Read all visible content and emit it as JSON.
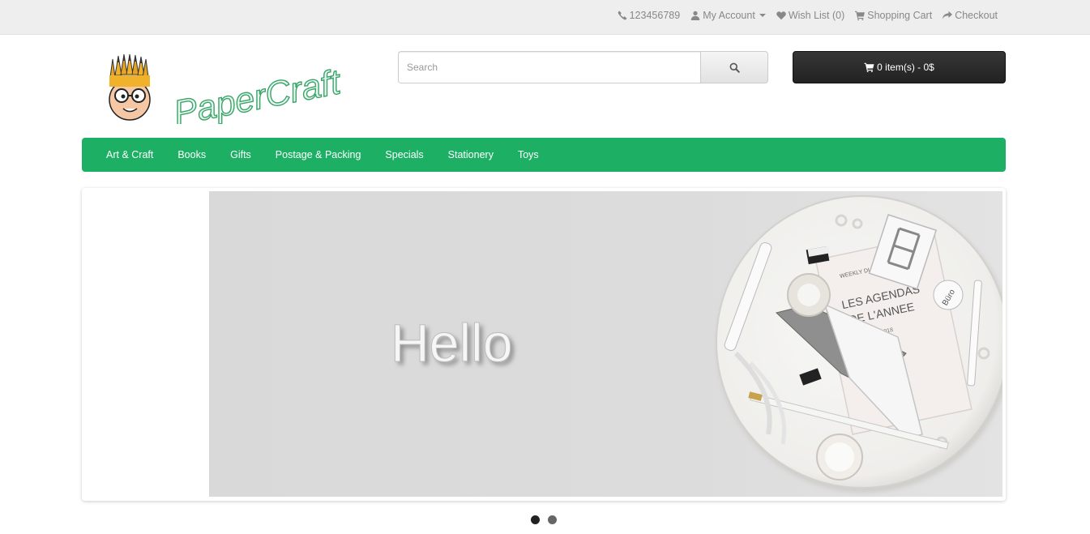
{
  "topbar": {
    "phone": "123456789",
    "my_account": "My Account",
    "wish_list": "Wish List (0)",
    "shopping_cart": "Shopping Cart",
    "checkout": "Checkout"
  },
  "logo": {
    "text": "PaperCraft"
  },
  "search": {
    "placeholder": "Search"
  },
  "cart": {
    "label": "0 item(s) - 0$"
  },
  "menu": {
    "items": [
      "Art & Craft",
      "Books",
      "Gifts",
      "Postage & Packing",
      "Specials",
      "Stationery",
      "Toys"
    ]
  },
  "banner": {
    "headline": "Hello",
    "book_line1": "LES AGENDAS",
    "book_line2": "DE L'ANNEE",
    "book_year": "2018",
    "book_small": "WEEKLY DIARY",
    "tag": "Büro"
  },
  "colors": {
    "menu_green": "#1daf63",
    "topbar_bg": "#eeeeee",
    "cart_dark": "#2a2a2a"
  },
  "icons": [
    "phone-icon",
    "user-icon",
    "heart-icon",
    "cart-icon",
    "share-icon",
    "search-icon"
  ]
}
